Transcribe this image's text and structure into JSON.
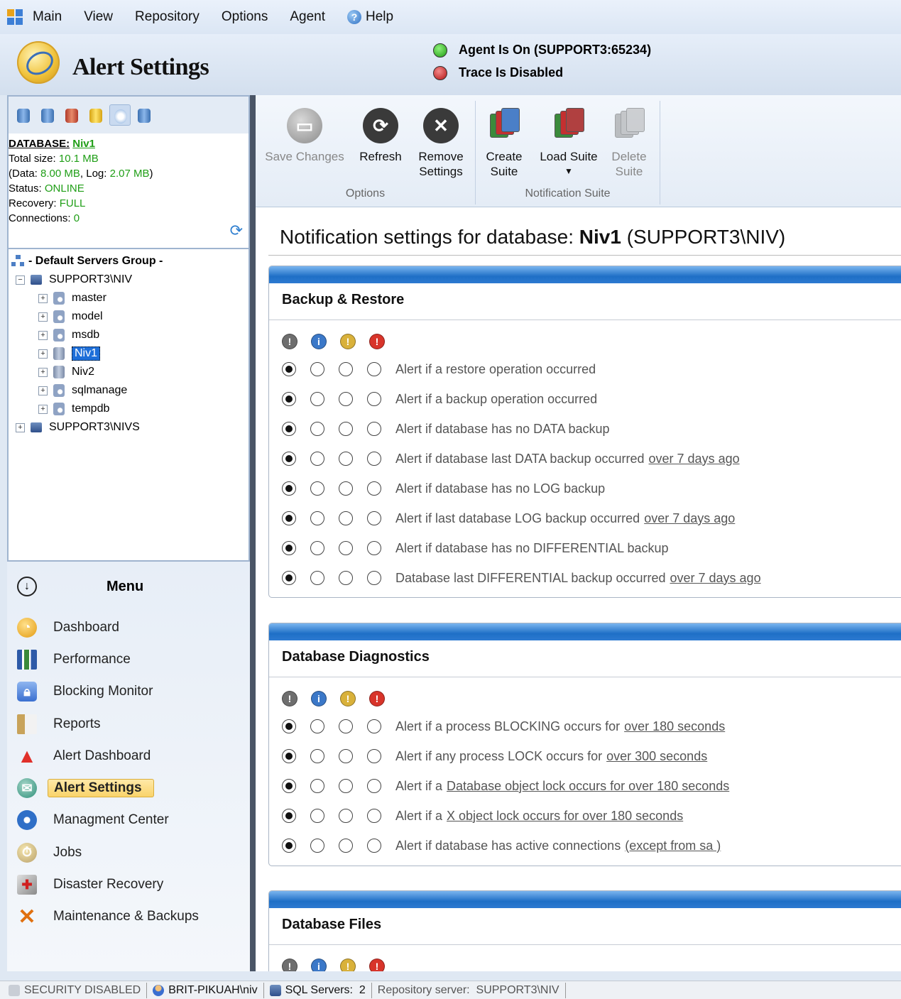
{
  "menubar": {
    "items": [
      "Main",
      "View",
      "Repository",
      "Options",
      "Agent"
    ],
    "help": "Help"
  },
  "header": {
    "title": "Alert Settings",
    "agent_status": "Agent Is On (SUPPORT3:65234)",
    "trace_status": "Trace Is Disabled",
    "colors": {
      "agent_on": "#1f9a14",
      "trace_off": "#b31212"
    }
  },
  "db_info": {
    "database_label": "DATABASE:",
    "database_name": "Niv1",
    "total_size_label": "Total size:",
    "total_size": "10.1 MB",
    "data_label": "(Data:",
    "data_size": "8.00 MB",
    "log_label": ", Log:",
    "log_size": "2.07 MB",
    "close_paren": ")",
    "status_label": "Status:",
    "status": "ONLINE",
    "recovery_label": "Recovery:",
    "recovery": "FULL",
    "connections_label": "Connections:",
    "connections": "0"
  },
  "tree": {
    "group": "- Default Servers Group -",
    "server1": "SUPPORT3\\NIV",
    "databases": [
      "master",
      "model",
      "msdb",
      "Niv1",
      "Niv2",
      "sqlmanage",
      "tempdb"
    ],
    "selected": "Niv1",
    "server2": "SUPPORT3\\NIVS"
  },
  "menu": {
    "title": "Menu",
    "items": [
      {
        "label": "Dashboard",
        "icon": "dashboard-icon"
      },
      {
        "label": "Performance",
        "icon": "performance-icon"
      },
      {
        "label": "Blocking Monitor",
        "icon": "lock-icon"
      },
      {
        "label": "Reports",
        "icon": "reports-icon"
      },
      {
        "label": "Alert Dashboard",
        "icon": "alert-icon"
      },
      {
        "label": "Alert Settings",
        "icon": "envelope-icon"
      },
      {
        "label": "Managment Center",
        "icon": "management-icon"
      },
      {
        "label": "Jobs",
        "icon": "jobs-icon"
      },
      {
        "label": "Disaster Recovery",
        "icon": "disaster-recovery-icon"
      },
      {
        "label": "Maintenance & Backups",
        "icon": "tools-icon"
      }
    ],
    "active": "Alert Settings"
  },
  "ribbon": {
    "save": "Save Changes",
    "refresh": "Refresh",
    "remove_1": "Remove",
    "remove_2": "Settings",
    "options_group": "Options",
    "create_1": "Create",
    "create_2": "Suite",
    "load": "Load Suite",
    "delete_1": "Delete",
    "delete_2": "Suite",
    "suite_group": "Notification Suite"
  },
  "page": {
    "title_prefix": "Notification settings for database:",
    "db": "Niv1",
    "server": "(SUPPORT3\\NIV)"
  },
  "severity_colors": [
    "#6e6e6e",
    "#3b78c8",
    "#d9b13a",
    "#d8342a"
  ],
  "sections": [
    {
      "title": "Backup & Restore",
      "alerts": [
        {
          "text": "Alert if a restore operation occurred",
          "link": "",
          "severity": 0
        },
        {
          "text": "Alert if a backup operation occurred",
          "link": "",
          "severity": 0
        },
        {
          "text": "Alert if database has no DATA backup",
          "link": "",
          "severity": 0
        },
        {
          "text": "Alert if database last DATA backup occurred",
          "link": "over 7 days ago",
          "severity": 0
        },
        {
          "text": "Alert if database has no LOG backup",
          "link": "",
          "severity": 0
        },
        {
          "text": "Alert if last database LOG backup occurred",
          "link": "over 7 days ago",
          "severity": 0
        },
        {
          "text": "Alert if database has no DIFFERENTIAL backup",
          "link": "",
          "severity": 0
        },
        {
          "text": "Database last DIFFERENTIAL backup occurred",
          "link": "over 7 days ago",
          "severity": 0
        }
      ]
    },
    {
      "title": "Database Diagnostics",
      "alerts": [
        {
          "text": "Alert if a process BLOCKING occurs for",
          "link": "over 180 seconds",
          "severity": 0
        },
        {
          "text": "Alert if any process LOCK occurs for",
          "link": "over 300 seconds",
          "severity": 0
        },
        {
          "text": "Alert if a",
          "link": "Database object lock occurs for over 180 seconds",
          "severity": 0
        },
        {
          "text": "Alert if a",
          "link": "X object lock occurs for over 180 seconds",
          "severity": 0
        },
        {
          "text": "Alert if database has active connections",
          "link": "(except from sa )",
          "severity": 0
        }
      ]
    },
    {
      "title": "Database Files",
      "alerts": []
    }
  ],
  "statusbar": {
    "security": "SECURITY DISABLED",
    "user": "BRIT-PIKUAH\\niv",
    "sql_servers_label": "SQL Servers:",
    "sql_servers_count": "2",
    "repository_label": "Repository server:",
    "repository": "SUPPORT3\\NIV"
  }
}
